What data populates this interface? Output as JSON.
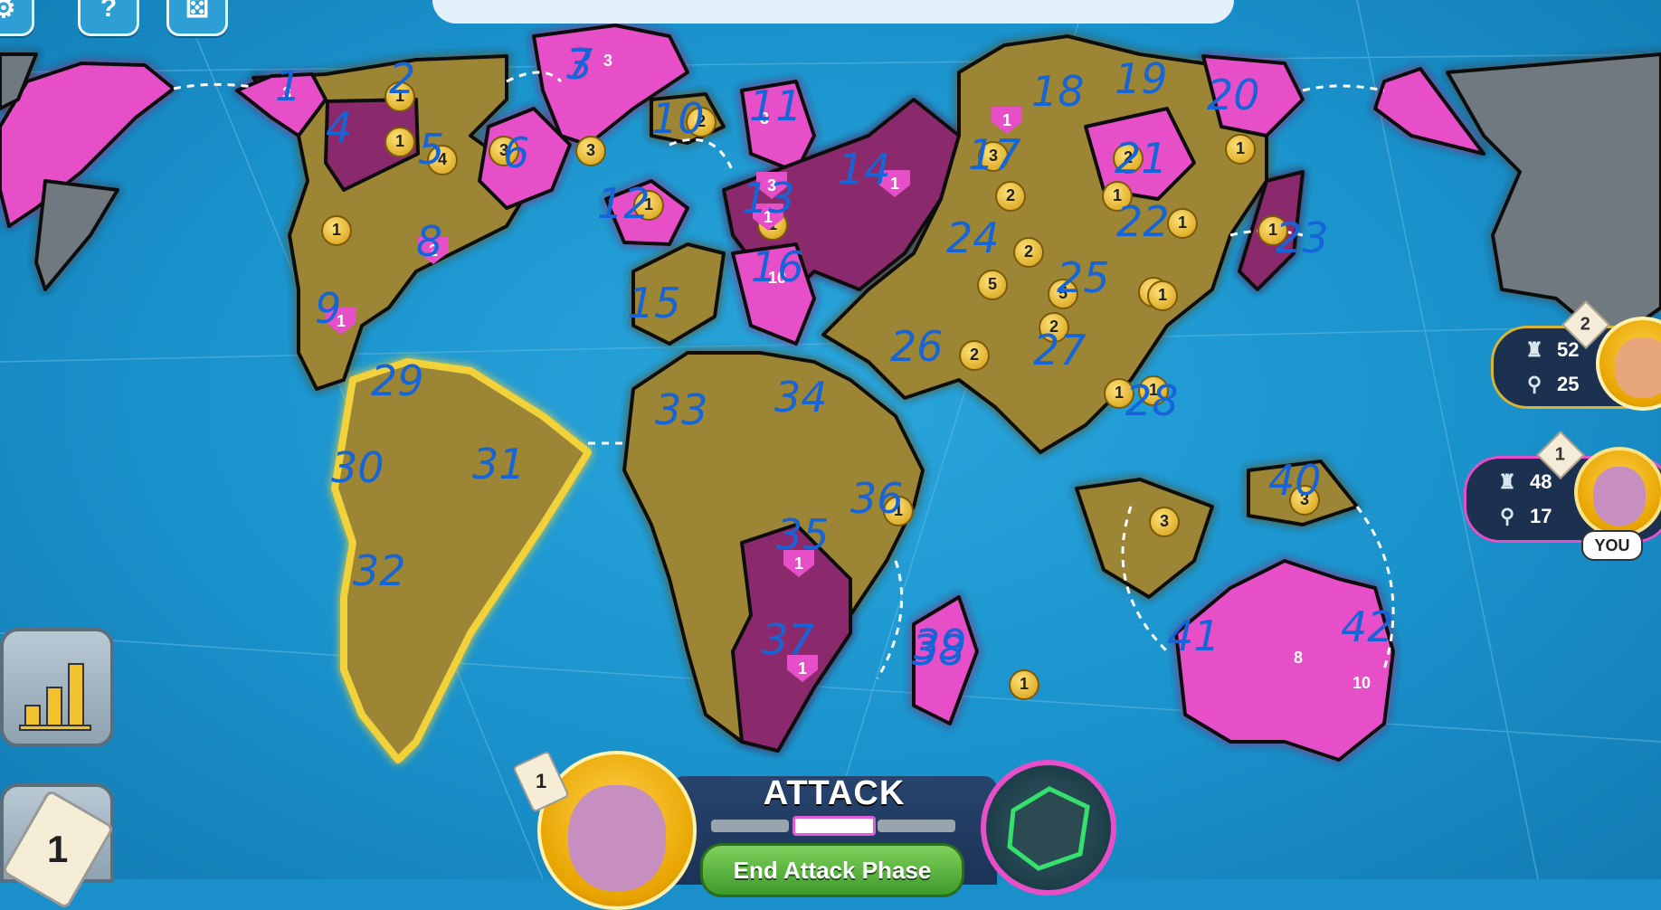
{
  "top_controls": {
    "settings_icon": "gear-icon",
    "help_label": "?",
    "dice_icon": "dice-icon"
  },
  "phase": {
    "title": "ATTACK",
    "end_button": "End Attack Phase",
    "active_segment": 2,
    "segments": 3
  },
  "players": [
    {
      "rank": "2",
      "troops": "52",
      "territories": "25",
      "you_label": "",
      "color": "#c8a22a"
    },
    {
      "rank": "1",
      "troops": "48",
      "territories": "17",
      "you_label": "YOU",
      "color": "#e64fc8"
    }
  ],
  "current_player": {
    "cards": "1"
  },
  "sidebar": {
    "stats_icon": "bar-chart-icon",
    "cards_count": "1"
  },
  "colors": {
    "ocean": "#1a8fc9",
    "gold_owner": "#9c8536",
    "pink_owner": "#e64fc8",
    "purple_owner": "#8a2a6c",
    "neutral": "#6f7880",
    "end_button": "#4caf35"
  },
  "troop_markers": [
    {
      "value": "3",
      "style": "shield"
    },
    {
      "value": "1",
      "style": "gold"
    },
    {
      "value": "3",
      "style": "shield"
    },
    {
      "value": "2",
      "style": "gold"
    },
    {
      "value": "1",
      "style": "gold"
    },
    {
      "value": "4",
      "style": "gold"
    },
    {
      "value": "1",
      "style": "gold"
    },
    {
      "value": "2",
      "style": "shield"
    },
    {
      "value": "1",
      "style": "shield"
    },
    {
      "value": "3",
      "style": "gold"
    },
    {
      "value": "3",
      "style": "gold"
    },
    {
      "value": "1",
      "style": "gold"
    },
    {
      "value": "3",
      "style": "shield"
    },
    {
      "value": "3",
      "style": "shield"
    },
    {
      "value": "1",
      "style": "gold"
    },
    {
      "value": "1",
      "style": "shield"
    },
    {
      "value": "1",
      "style": "shield"
    },
    {
      "value": "10",
      "style": "shield"
    },
    {
      "value": "3",
      "style": "gold"
    },
    {
      "value": "2",
      "style": "gold"
    },
    {
      "value": "1",
      "style": "shield"
    },
    {
      "value": "5",
      "style": "gold"
    },
    {
      "value": "2",
      "style": "gold"
    },
    {
      "value": "2",
      "style": "gold"
    },
    {
      "value": "2",
      "style": "gold"
    },
    {
      "value": "1",
      "style": "gold"
    },
    {
      "value": "1",
      "style": "gold"
    },
    {
      "value": "1",
      "style": "gold"
    },
    {
      "value": "2",
      "style": "gold"
    },
    {
      "value": "1",
      "style": "gold"
    },
    {
      "value": "5",
      "style": "gold"
    },
    {
      "value": "2",
      "style": "gold"
    },
    {
      "value": "1",
      "style": "gold"
    },
    {
      "value": "1",
      "style": "gold"
    },
    {
      "value": "1",
      "style": "gold"
    },
    {
      "value": "3",
      "style": "gold"
    },
    {
      "value": "1",
      "style": "shield"
    },
    {
      "value": "1",
      "style": "shield"
    },
    {
      "value": "8",
      "style": "shield"
    },
    {
      "value": "10",
      "style": "shield"
    },
    {
      "value": "1",
      "style": "gold"
    },
    {
      "value": "3",
      "style": "gold"
    },
    {
      "value": "1",
      "style": "gold"
    }
  ],
  "annotations": [
    "1",
    "2",
    "3",
    "4",
    "5",
    "6",
    "7",
    "8",
    "9",
    "10",
    "11",
    "12",
    "13",
    "14",
    "15",
    "16",
    "17",
    "18",
    "19",
    "20",
    "21",
    "22",
    "23",
    "24",
    "25",
    "26",
    "27",
    "28",
    "29",
    "30",
    "31",
    "32",
    "33",
    "34",
    "35",
    "36",
    "37",
    "38",
    "39",
    "40",
    "41",
    "42"
  ]
}
